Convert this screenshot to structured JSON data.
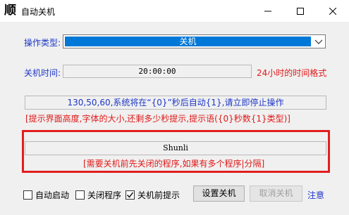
{
  "window": {
    "icon_glyph": "顺",
    "title": "自动关机"
  },
  "form": {
    "op_type_label": "操作类型:",
    "op_type_value": "关机",
    "shutdown_time_label": "关机时间:",
    "shutdown_time_value": "20:00:00",
    "time_format_hint": "24小时的时间格式",
    "prompt_seconds_value": "130,50,60,系统将在“{0}”秒后自动{1},请立即停止操作",
    "prompt_hint": "[提示界面高度,字体的大小,还剩多少秒提示,提示语({0}秒数{1}类型)]",
    "close_programs_value": "Shunli",
    "close_programs_hint": "[需要关机前先关闭的程序,如果有多个程序|分隔]"
  },
  "options": {
    "auto_start_label": "自动启动",
    "auto_start_checked": false,
    "close_programs_label": "关闭程序",
    "close_programs_checked": false,
    "prompt_before_label": "关机前提示",
    "prompt_before_checked": true
  },
  "actions": {
    "set_shutdown_label": "设置关机",
    "cancel_shutdown_label": "取消关机",
    "notice_label": "注意"
  },
  "colors": {
    "accent_blue": "#0078d7",
    "label_blue": "#1d37c8",
    "hint_red": "#e01818",
    "highlight_frame_red": "#e21e1e"
  }
}
